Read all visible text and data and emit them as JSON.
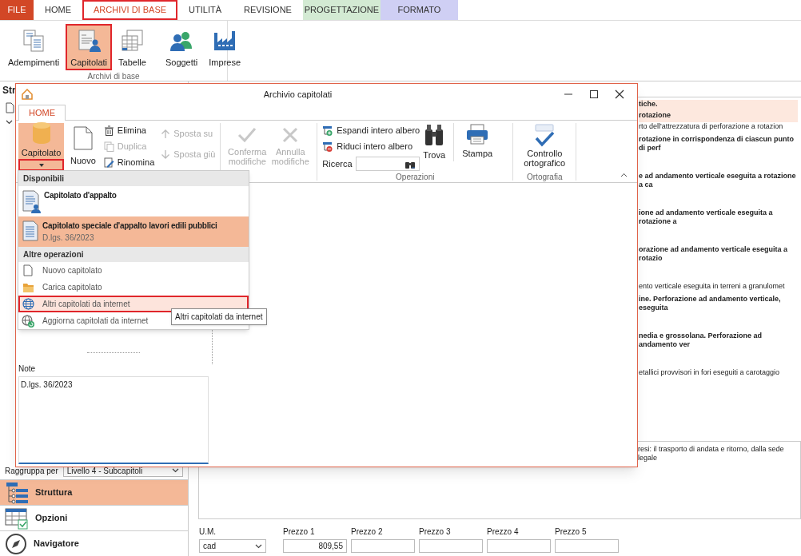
{
  "app_tabs": [
    {
      "label": "FILE",
      "kind": "file",
      "selected": false,
      "highlighted": false
    },
    {
      "label": "HOME",
      "kind": "tab",
      "selected": false,
      "highlighted": false
    },
    {
      "label": "ARCHIVI DI BASE",
      "kind": "tab",
      "selected": true,
      "highlighted": true
    },
    {
      "label": "UTILITÀ",
      "kind": "tab",
      "selected": false,
      "highlighted": false
    },
    {
      "label": "REVISIONE",
      "kind": "tab",
      "selected": false,
      "highlighted": false
    },
    {
      "label": "PROGETTAZIONE",
      "kind": "contextual",
      "color": "#d3ead3",
      "selected": false,
      "highlighted": false
    },
    {
      "label": "FORMATO",
      "kind": "contextual",
      "color": "#cfcff4",
      "selected": false,
      "highlighted": false
    }
  ],
  "ribbon": {
    "buttons": [
      {
        "label": "Adempimenti",
        "selected": false,
        "highlighted": false
      },
      {
        "label": "Capitolati",
        "selected": true,
        "highlighted": true
      },
      {
        "label": "Tabelle",
        "selected": false,
        "highlighted": false
      },
      {
        "label": "Soggetti",
        "selected": false,
        "highlighted": false
      },
      {
        "label": "Imprese",
        "selected": false,
        "highlighted": false
      }
    ],
    "group_label": "Archivi di base"
  },
  "side_panel": {
    "title": "Str"
  },
  "background_rows": [
    {
      "kind": "header",
      "text": "tiche."
    },
    {
      "kind": "header",
      "text": "rotazione"
    },
    {
      "kind": "detail",
      "text": "rto dell'attrezzatura di perforazione a rotazion"
    },
    {
      "kind": "title",
      "text": "rotazione in corrispondenza di ciascun punto di perf"
    },
    {
      "kind": "title",
      "text": "e ad andamento verticale eseguita a rotazione a ca"
    },
    {
      "kind": "title",
      "text": "ione ad andamento verticale eseguita a rotazione a"
    },
    {
      "kind": "title",
      "text": "orazione ad andamento verticale eseguita a rotazio"
    },
    {
      "kind": "detail",
      "text": "ento verticale eseguita in terreni a granulomet"
    },
    {
      "kind": "title",
      "text": "ine. Perforazione ad andamento verticale, eseguita"
    },
    {
      "kind": "title",
      "text": "nedia e grossolana. Perforazione ad andamento ver"
    },
    {
      "kind": "detail",
      "text": "etallici provvisori in fori eseguiti a carotaggio"
    }
  ],
  "description": "resi: il trasporto di andata e ritorno, dalla sede legale",
  "group_by": {
    "label": "Raggruppa per",
    "value": "Livello 4 - Subcapitoli"
  },
  "nav": [
    {
      "label": "Struttura",
      "selected": true
    },
    {
      "label": "Opzioni",
      "selected": false
    },
    {
      "label": "Navigatore",
      "selected": false
    }
  ],
  "prices": [
    {
      "label": "U.M.",
      "kind": "select",
      "value": "cad"
    },
    {
      "label": "Prezzo 1",
      "kind": "input",
      "value": "809,55"
    },
    {
      "label": "Prezzo 2",
      "kind": "input"
    },
    {
      "label": "Prezzo 3",
      "kind": "input"
    },
    {
      "label": "Prezzo 4",
      "kind": "input"
    },
    {
      "label": "Prezzo 5",
      "kind": "input"
    }
  ],
  "dialog": {
    "title": "Archivio capitolati",
    "tabs": [
      {
        "label": "HOME",
        "selected": true
      }
    ],
    "capitolato_button": {
      "label": "Capitolato",
      "selected": true,
      "dropdown_highlighted": true
    },
    "new_button": {
      "label": "Nuovo"
    },
    "edit_buttons": [
      {
        "label": "Elimina",
        "disabled": false
      },
      {
        "label": "Duplica",
        "disabled": true
      },
      {
        "label": "Rinomina",
        "disabled": false
      }
    ],
    "move_buttons": [
      {
        "label": "Sposta su",
        "disabled": true
      },
      {
        "label": "Sposta giù",
        "disabled": true
      }
    ],
    "commit_buttons": [
      {
        "label": "Conferma modifiche",
        "disabled": true
      },
      {
        "label": "Annulla modifiche",
        "disabled": true
      }
    ],
    "tree_buttons": [
      {
        "label": "Espandi intero albero"
      },
      {
        "label": "Riduci intero albero"
      }
    ],
    "search": {
      "label": "Ricerca"
    },
    "tool_buttons": [
      {
        "label": "Trova"
      },
      {
        "label": "Stampa"
      }
    ],
    "operations_label": "Operazioni",
    "spell_button": {
      "label": "Controllo ortografico"
    },
    "spelling_label": "Ortografia",
    "notes": {
      "label": "Note",
      "value": "D.lgs. 36/2023"
    }
  },
  "menu": {
    "sections": [
      {
        "title": "Disponibili",
        "kind": "documents",
        "items": [
          {
            "label": "Capitolato d'appalto",
            "selected": false,
            "hovered": false,
            "highlighted": false
          },
          {
            "label": "Capitolato speciale d'appalto lavori edili pubblici",
            "subtitle": "D.lgs. 36/2023",
            "selected": true,
            "hovered": false,
            "highlighted": false
          }
        ]
      },
      {
        "title": "Altre operazioni",
        "kind": "actions",
        "items": [
          {
            "label": "Nuovo capitolato",
            "selected": false,
            "hovered": false,
            "highlighted": false
          },
          {
            "label": "Carica capitolato",
            "selected": false,
            "hovered": false,
            "highlighted": false
          },
          {
            "label": "Altri capitolati da internet",
            "selected": false,
            "hovered": true,
            "highlighted": true
          },
          {
            "label": "Aggiorna capitolati da internet",
            "selected": false,
            "hovered": false,
            "highlighted": false
          }
        ]
      }
    ]
  },
  "tooltip": {
    "text": "Altri capitolati da internet"
  }
}
